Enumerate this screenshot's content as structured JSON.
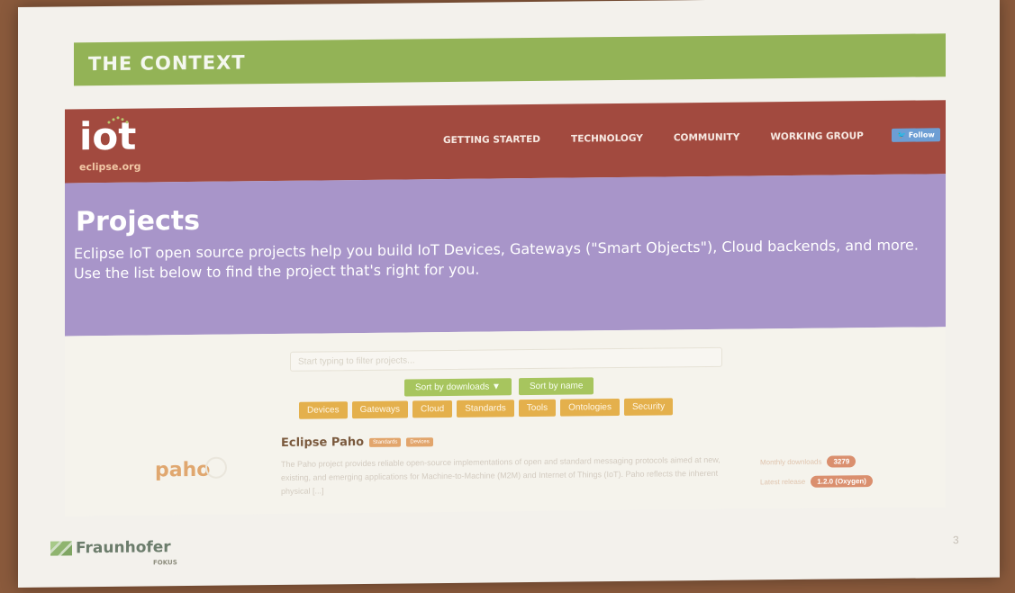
{
  "slide": {
    "title": "THE CONTEXT",
    "page_number": "3"
  },
  "site": {
    "logo": "iot",
    "logo_sub": "eclipse.org",
    "nav": [
      "GETTING STARTED",
      "TECHNOLOGY",
      "COMMUNITY",
      "WORKING GROUP"
    ],
    "follow": "Follow"
  },
  "hero": {
    "title": "Projects",
    "line1": "Eclipse IoT open source projects help you build IoT Devices, Gateways (\"Smart Objects\"), Cloud backends, and more.",
    "line2": "Use the list below to find the project that's right for you."
  },
  "search": {
    "placeholder": "Start typing to filter projects..."
  },
  "sort": {
    "downloads": "Sort by downloads ▼",
    "name": "Sort by name"
  },
  "filters": [
    "Devices",
    "Gateways",
    "Cloud",
    "Standards",
    "Tools",
    "Ontologies",
    "Security"
  ],
  "project": {
    "name": "Eclipse Paho",
    "tags": [
      "Standards",
      "Devices"
    ],
    "logo": "paho",
    "description": "The Paho project provides reliable open-source implementations of open and standard messaging protocols aimed at new, existing, and emerging applications for Machine-to-Machine (M2M) and Internet of Things (IoT). Paho reflects the inherent physical [...]",
    "monthly_label": "Monthly downloads",
    "monthly_value": "3279",
    "latest_label": "Latest release",
    "latest_value": "1.2.0 (Oxygen)"
  },
  "footer": {
    "brand": "Fraunhofer",
    "sub": "FOKUS"
  },
  "colors": {
    "title_bar": "#93b356",
    "header": "#a24a3f",
    "hero": "#a895c9"
  }
}
